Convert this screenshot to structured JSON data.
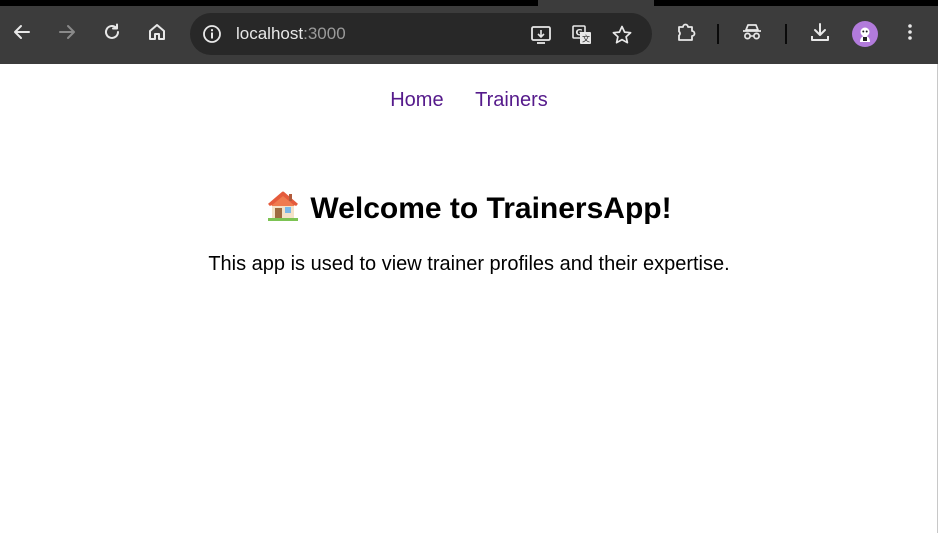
{
  "browser": {
    "url_host": "localhost",
    "url_port": ":3000",
    "icons": {
      "back": "arrow-left-icon",
      "forward": "arrow-right-icon",
      "reload": "reload-icon",
      "home": "home-icon",
      "site_info": "info-icon",
      "install": "install-app-icon",
      "translate": "translate-icon",
      "bookmark": "star-icon",
      "extensions": "puzzle-icon",
      "incognito": "incognito-icon",
      "downloads": "download-icon",
      "profile": "avatar-icon",
      "menu": "kebab-menu-icon"
    },
    "colors": {
      "toolbar": "#3c3c3c",
      "omnibox": "#282828",
      "avatar": "#b27bdc"
    }
  },
  "nav": {
    "home_label": "Home",
    "trainers_label": "Trainers",
    "link_color": "#551a8b"
  },
  "main": {
    "title_emoji": "house-emoji",
    "title": "Welcome to TrainersApp!",
    "intro": "This app is used to view trainer profiles and their expertise."
  }
}
